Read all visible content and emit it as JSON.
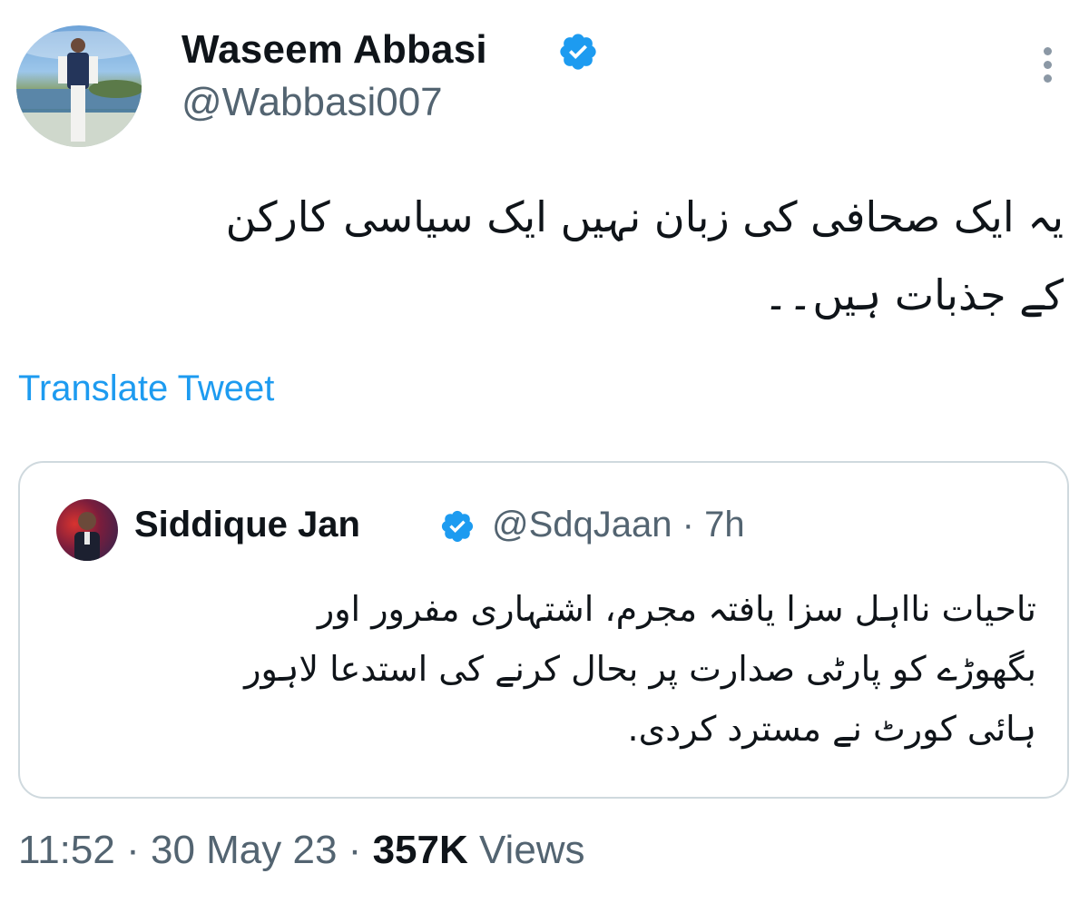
{
  "tweet": {
    "author": {
      "name": "Waseem Abbasi",
      "handle": "@Wabbasi007",
      "verified": true
    },
    "text_lines": [
      "یہ ایک صحافی کی زبان نہیں ایک سیاسی کارکن",
      "کے جذبات ہیں۔۔"
    ],
    "translate_label": "Translate Tweet",
    "quote": {
      "name": "Siddique Jan",
      "handle": "@SdqJaan",
      "separator": "·",
      "time": "7h",
      "verified": true,
      "text_lines": [
        "تاحیات نااہل سزا یافتہ مجرم، اشتہاری مفرور اور",
        "بگھوڑے کو پارٹی صدارت پر بحال کرنے کی استدعا لاہور",
        "ہائی کورٹ نے مسترد کردی."
      ]
    },
    "footer": {
      "time": "11:52",
      "sep1": "·",
      "date": "30 May 23",
      "sep2": "·",
      "views_count": "357K",
      "views_label": "Views"
    }
  },
  "icons": {
    "verified": "verified-badge-icon",
    "more": "more-vertical-icon"
  },
  "colors": {
    "link": "#1d9bf0",
    "secondary_text": "#536471",
    "border": "#cfd9de",
    "verified": "#1d9bf0"
  }
}
